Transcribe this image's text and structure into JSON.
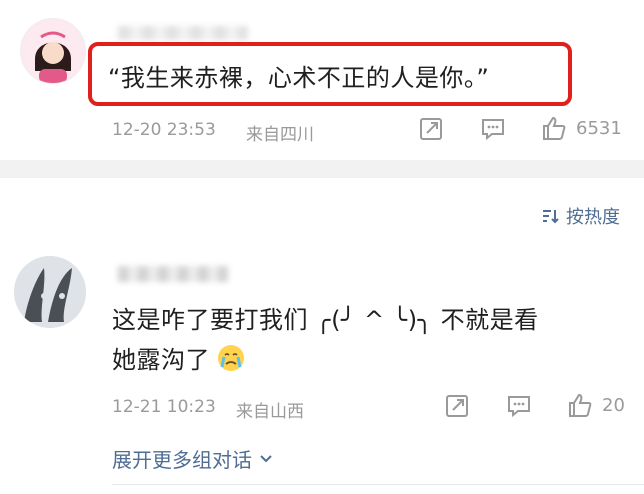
{
  "comment1": {
    "text": "“我生来赤裸，心术不正的人是你。”",
    "time": "12-20 23:53",
    "location": "来自四川",
    "likes": "6531"
  },
  "sort": {
    "label": "按热度"
  },
  "comment2": {
    "text_line1": "这是咋了要打我们 ╭(╯ ^ ╰)╮ 不就是看",
    "text_line2": "她露沟了",
    "time": "12-21 10:23",
    "location": "来自山西",
    "likes": "20"
  },
  "more_replies": {
    "label": "展开更多组对话"
  },
  "colors": {
    "highlight_border": "#e0201b",
    "link": "#506d94",
    "meta": "#9a9a9a"
  }
}
